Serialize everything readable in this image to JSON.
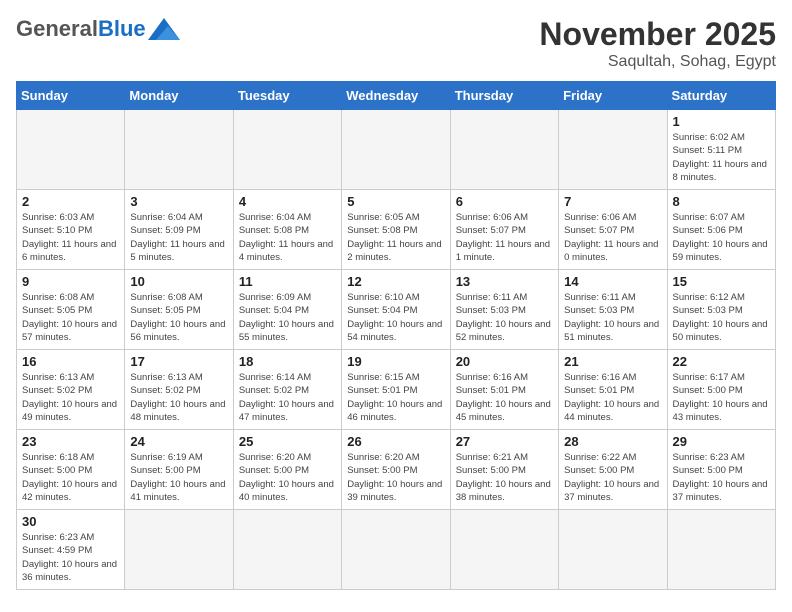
{
  "header": {
    "logo_general": "General",
    "logo_blue": "Blue",
    "month_title": "November 2025",
    "location": "Saqultah, Sohag, Egypt"
  },
  "weekdays": [
    "Sunday",
    "Monday",
    "Tuesday",
    "Wednesday",
    "Thursday",
    "Friday",
    "Saturday"
  ],
  "weeks": [
    [
      {
        "day": "",
        "empty": true
      },
      {
        "day": "",
        "empty": true
      },
      {
        "day": "",
        "empty": true
      },
      {
        "day": "",
        "empty": true
      },
      {
        "day": "",
        "empty": true
      },
      {
        "day": "",
        "empty": true
      },
      {
        "day": "1",
        "sunrise": "6:02 AM",
        "sunset": "5:11 PM",
        "daylight": "11 hours and 8 minutes."
      }
    ],
    [
      {
        "day": "2",
        "sunrise": "6:03 AM",
        "sunset": "5:10 PM",
        "daylight": "11 hours and 6 minutes."
      },
      {
        "day": "3",
        "sunrise": "6:04 AM",
        "sunset": "5:09 PM",
        "daylight": "11 hours and 5 minutes."
      },
      {
        "day": "4",
        "sunrise": "6:04 AM",
        "sunset": "5:08 PM",
        "daylight": "11 hours and 4 minutes."
      },
      {
        "day": "5",
        "sunrise": "6:05 AM",
        "sunset": "5:08 PM",
        "daylight": "11 hours and 2 minutes."
      },
      {
        "day": "6",
        "sunrise": "6:06 AM",
        "sunset": "5:07 PM",
        "daylight": "11 hours and 1 minute."
      },
      {
        "day": "7",
        "sunrise": "6:06 AM",
        "sunset": "5:07 PM",
        "daylight": "11 hours and 0 minutes."
      },
      {
        "day": "8",
        "sunrise": "6:07 AM",
        "sunset": "5:06 PM",
        "daylight": "10 hours and 59 minutes."
      }
    ],
    [
      {
        "day": "9",
        "sunrise": "6:08 AM",
        "sunset": "5:05 PM",
        "daylight": "10 hours and 57 minutes."
      },
      {
        "day": "10",
        "sunrise": "6:08 AM",
        "sunset": "5:05 PM",
        "daylight": "10 hours and 56 minutes."
      },
      {
        "day": "11",
        "sunrise": "6:09 AM",
        "sunset": "5:04 PM",
        "daylight": "10 hours and 55 minutes."
      },
      {
        "day": "12",
        "sunrise": "6:10 AM",
        "sunset": "5:04 PM",
        "daylight": "10 hours and 54 minutes."
      },
      {
        "day": "13",
        "sunrise": "6:11 AM",
        "sunset": "5:03 PM",
        "daylight": "10 hours and 52 minutes."
      },
      {
        "day": "14",
        "sunrise": "6:11 AM",
        "sunset": "5:03 PM",
        "daylight": "10 hours and 51 minutes."
      },
      {
        "day": "15",
        "sunrise": "6:12 AM",
        "sunset": "5:03 PM",
        "daylight": "10 hours and 50 minutes."
      }
    ],
    [
      {
        "day": "16",
        "sunrise": "6:13 AM",
        "sunset": "5:02 PM",
        "daylight": "10 hours and 49 minutes."
      },
      {
        "day": "17",
        "sunrise": "6:13 AM",
        "sunset": "5:02 PM",
        "daylight": "10 hours and 48 minutes."
      },
      {
        "day": "18",
        "sunrise": "6:14 AM",
        "sunset": "5:02 PM",
        "daylight": "10 hours and 47 minutes."
      },
      {
        "day": "19",
        "sunrise": "6:15 AM",
        "sunset": "5:01 PM",
        "daylight": "10 hours and 46 minutes."
      },
      {
        "day": "20",
        "sunrise": "6:16 AM",
        "sunset": "5:01 PM",
        "daylight": "10 hours and 45 minutes."
      },
      {
        "day": "21",
        "sunrise": "6:16 AM",
        "sunset": "5:01 PM",
        "daylight": "10 hours and 44 minutes."
      },
      {
        "day": "22",
        "sunrise": "6:17 AM",
        "sunset": "5:00 PM",
        "daylight": "10 hours and 43 minutes."
      }
    ],
    [
      {
        "day": "23",
        "sunrise": "6:18 AM",
        "sunset": "5:00 PM",
        "daylight": "10 hours and 42 minutes."
      },
      {
        "day": "24",
        "sunrise": "6:19 AM",
        "sunset": "5:00 PM",
        "daylight": "10 hours and 41 minutes."
      },
      {
        "day": "25",
        "sunrise": "6:20 AM",
        "sunset": "5:00 PM",
        "daylight": "10 hours and 40 minutes."
      },
      {
        "day": "26",
        "sunrise": "6:20 AM",
        "sunset": "5:00 PM",
        "daylight": "10 hours and 39 minutes."
      },
      {
        "day": "27",
        "sunrise": "6:21 AM",
        "sunset": "5:00 PM",
        "daylight": "10 hours and 38 minutes."
      },
      {
        "day": "28",
        "sunrise": "6:22 AM",
        "sunset": "5:00 PM",
        "daylight": "10 hours and 37 minutes."
      },
      {
        "day": "29",
        "sunrise": "6:23 AM",
        "sunset": "5:00 PM",
        "daylight": "10 hours and 37 minutes."
      }
    ],
    [
      {
        "day": "30",
        "sunrise": "6:23 AM",
        "sunset": "4:59 PM",
        "daylight": "10 hours and 36 minutes."
      },
      {
        "day": "",
        "empty": true
      },
      {
        "day": "",
        "empty": true
      },
      {
        "day": "",
        "empty": true
      },
      {
        "day": "",
        "empty": true
      },
      {
        "day": "",
        "empty": true
      },
      {
        "day": "",
        "empty": true
      }
    ]
  ],
  "labels": {
    "sunrise": "Sunrise:",
    "sunset": "Sunset:",
    "daylight": "Daylight:"
  }
}
